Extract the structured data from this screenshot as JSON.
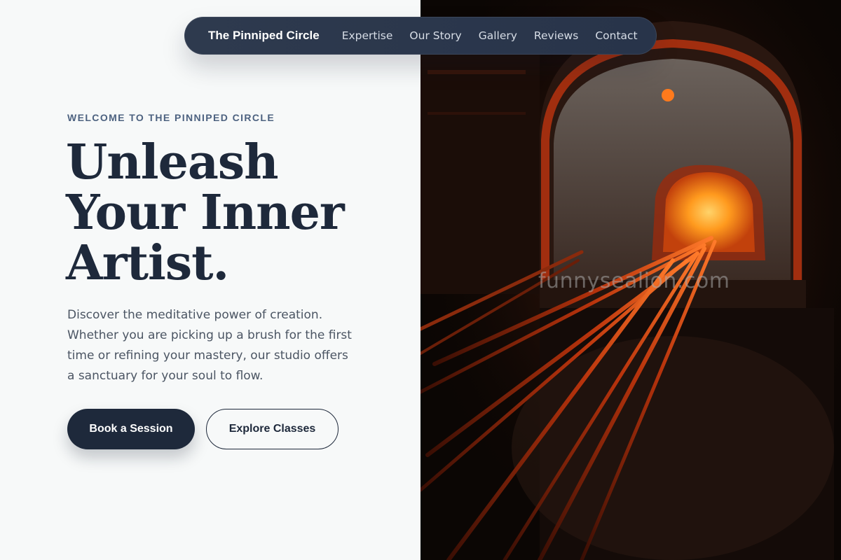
{
  "nav": {
    "brand": "The Pinniped Circle",
    "links": [
      "Expertise",
      "Our Story",
      "Gallery",
      "Reviews",
      "Contact"
    ]
  },
  "hero": {
    "eyebrow": "WELCOME TO THE PINNIPED CIRCLE",
    "headline_lines": [
      "Unleash",
      "Your Inner",
      "Artist."
    ],
    "description_lines": [
      "Discover the meditative power of creation.",
      "Whether you are picking up a brush for the first",
      "time or refining your mastery, our studio offers",
      "a sanctuary for your soul to flow."
    ],
    "primary_button": "Book a Session",
    "secondary_button": "Explore Classes"
  },
  "image": {
    "watermark": "funnysealion.com",
    "icon": "glass-furnace-photo"
  },
  "colors": {
    "background": "#f7f9f9",
    "navy": "#1e293b",
    "eyebrow": "#4d6280",
    "body_text": "#4b5563",
    "glow": "#ff8a1c"
  }
}
